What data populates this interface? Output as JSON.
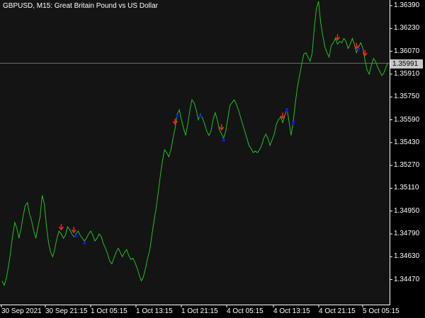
{
  "window": {
    "title": "GBPUSD, M15:  Great Britain Pound vs US Dollar"
  },
  "price_label": "1.35991",
  "colors": {
    "background": "#000000",
    "plot_bg": "#141414",
    "line": "#22c022",
    "up_arrow": "#ff2020",
    "dot": "#1010ff",
    "text": "#ffffff",
    "price_line": "#6a6a6a"
  },
  "chart_data": {
    "type": "line",
    "title": "GBPUSD, M15:  Great Britain Pound vs US Dollar",
    "symbol": "GBPUSD",
    "timeframe": "M15",
    "ylim": [
      1.3425,
      1.3648
    ],
    "y_ticks": [
      "1.36390",
      "1.36230",
      "1.36070",
      "1.35910",
      "1.35750",
      "1.35590",
      "1.35430",
      "1.35270",
      "1.35110",
      "1.34950",
      "1.34790",
      "1.34630",
      "1.34470"
    ],
    "x_ticks": [
      "30 Sep 2021",
      "30 Sep 21:15",
      "1 Oct 05:15",
      "1 Oct 13:15",
      "1 Oct 21:15",
      "4 Oct 05:15",
      "4 Oct 13:15",
      "4 Oct 21:15",
      "5 Oct 05:15"
    ],
    "current_price": 1.35991,
    "series": [
      {
        "values": [
          1.3446,
          1.3443,
          1.3448,
          1.3456,
          1.3466,
          1.3478,
          1.3487,
          1.3483,
          1.3476,
          1.3483,
          1.3492,
          1.3499,
          1.3501,
          1.3493,
          1.3488,
          1.3481,
          1.3476,
          1.3484,
          1.3491,
          1.3506,
          1.35,
          1.3485,
          1.3473,
          1.3466,
          1.3463,
          1.3469,
          1.3476,
          1.3481,
          1.3479,
          1.3476,
          1.3478,
          1.3484,
          1.3482,
          1.3479,
          1.3477,
          1.3479,
          1.3481,
          1.3478,
          1.3476,
          1.3474,
          1.3476,
          1.3479,
          1.3481,
          1.3478,
          1.3474,
          1.3476,
          1.3479,
          1.3477,
          1.3472,
          1.3469,
          1.3465,
          1.346,
          1.3458,
          1.3462,
          1.3466,
          1.3469,
          1.3466,
          1.3463,
          1.3466,
          1.3468,
          1.3464,
          1.3461,
          1.3462,
          1.3459,
          1.3455,
          1.345,
          1.3446,
          1.3449,
          1.3455,
          1.3462,
          1.3468,
          1.3478,
          1.3488,
          1.3497,
          1.3508,
          1.352,
          1.353,
          1.3538,
          1.3536,
          1.3533,
          1.3538,
          1.3546,
          1.3553,
          1.3563,
          1.3566,
          1.3559,
          1.3553,
          1.3548,
          1.3556,
          1.3566,
          1.3573,
          1.3571,
          1.3566,
          1.3559,
          1.3563,
          1.356,
          1.3556,
          1.3551,
          1.3548,
          1.3551,
          1.3559,
          1.3564,
          1.3559,
          1.3552,
          1.3549,
          1.3546,
          1.3551,
          1.356,
          1.3569,
          1.3571,
          1.3573,
          1.357,
          1.3566,
          1.3561,
          1.3556,
          1.3551,
          1.3546,
          1.3541,
          1.3539,
          1.3536,
          1.3537,
          1.3536,
          1.3538,
          1.3541,
          1.3546,
          1.3549,
          1.3546,
          1.3541,
          1.3545,
          1.3549,
          1.3556,
          1.3559,
          1.3561,
          1.3557,
          1.3562,
          1.3567,
          1.3558,
          1.3548,
          1.3558,
          1.3571,
          1.3582,
          1.359,
          1.3598,
          1.3605,
          1.3606,
          1.3603,
          1.36,
          1.3606,
          1.3624,
          1.3637,
          1.3642,
          1.3627,
          1.3618,
          1.361,
          1.3606,
          1.3603,
          1.3611,
          1.3613,
          1.3616,
          1.3612,
          1.3614,
          1.3613,
          1.3616,
          1.3614,
          1.3609,
          1.3612,
          1.3616,
          1.3612,
          1.3606,
          1.361,
          1.3613,
          1.3609,
          1.3601,
          1.3594,
          1.3591,
          1.3597,
          1.3602,
          1.36,
          1.3596,
          1.3593,
          1.359,
          1.3592,
          1.3596,
          1.3599
        ]
      }
    ]
  }
}
